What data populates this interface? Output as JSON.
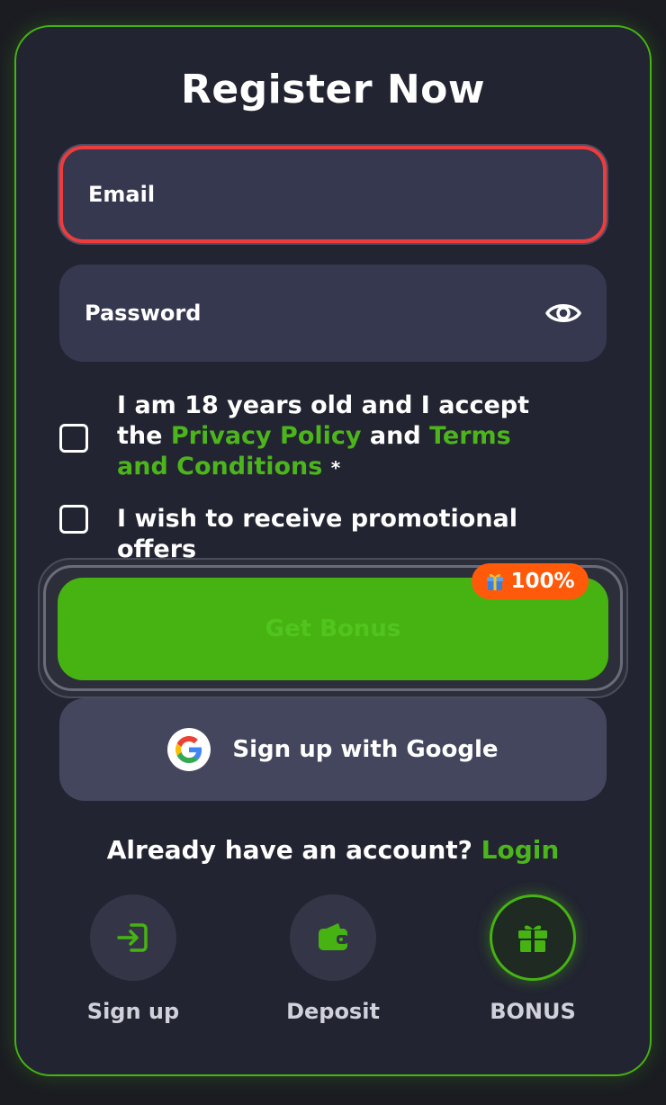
{
  "form": {
    "title": "Register Now",
    "email_placeholder": "Email",
    "password_placeholder": "Password"
  },
  "consent": {
    "age_text_1": "I am 18 years old and I accept the",
    "privacy_link": "Privacy Policy",
    "and": "and",
    "terms_link": "Terms and Conditions",
    "required_mark": "*",
    "promo_text": "I wish to receive promotional offers"
  },
  "actions": {
    "bonus_label": "Get Bonus",
    "bonus_badge": "100%",
    "google_label": "Sign up with Google"
  },
  "login_prompt": {
    "text": "Already have an account?",
    "link": "Login"
  },
  "nav": {
    "items": [
      {
        "label": "Sign up",
        "icon": "sign-in-icon"
      },
      {
        "label": "Deposit",
        "icon": "wallet-icon"
      },
      {
        "label": "BONUS",
        "icon": "gift-icon",
        "active": true
      }
    ]
  },
  "colors": {
    "accent": "#46b312",
    "error_border": "#ee3b3b",
    "badge": "#ff5a0a",
    "background": "#222431"
  }
}
